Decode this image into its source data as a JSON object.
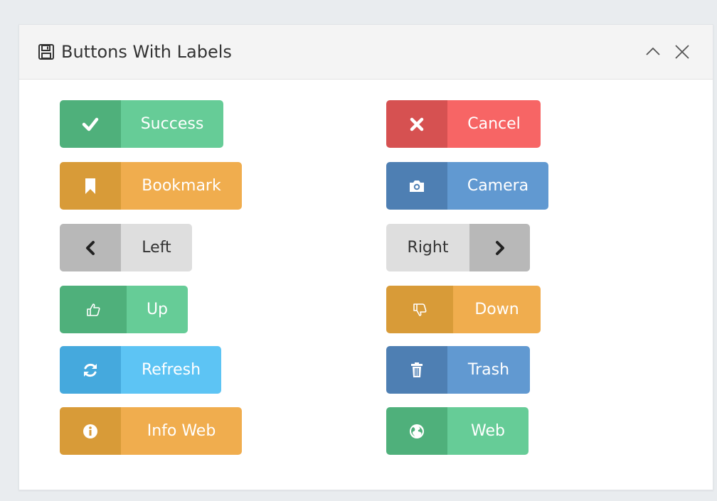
{
  "panel": {
    "title": "Buttons With Labels",
    "title_icon": "floppy-disk-icon",
    "tools": [
      "chevron-up-icon",
      "close-icon"
    ]
  },
  "buttons": {
    "success": {
      "label": "Success",
      "icon": "check-icon"
    },
    "cancel": {
      "label": "Cancel",
      "icon": "x-mark-icon"
    },
    "bookmark": {
      "label": "Bookmark",
      "icon": "bookmark-icon"
    },
    "camera": {
      "label": "Camera",
      "icon": "camera-icon"
    },
    "left": {
      "label": "Left",
      "icon": "chevron-left-icon"
    },
    "right": {
      "label": "Right",
      "icon": "chevron-right-icon"
    },
    "up": {
      "label": "Up",
      "icon": "thumbs-up-icon"
    },
    "down": {
      "label": "Down",
      "icon": "thumbs-down-icon"
    },
    "refresh": {
      "label": "Refresh",
      "icon": "refresh-icon"
    },
    "trash": {
      "label": "Trash",
      "icon": "trash-icon"
    },
    "info_web": {
      "label": "Info Web",
      "icon": "info-icon"
    },
    "web": {
      "label": "Web",
      "icon": "globe-icon"
    }
  },
  "colors": {
    "green_dark": "#4fb07b",
    "green": "#66cc97",
    "red_dark": "#d65151",
    "red": "#f76565",
    "orange_dark": "#d89b38",
    "orange": "#f0ad4e",
    "blue_dark": "#4e7fb3",
    "blue": "#6199d1",
    "gray_dark": "#b8b8b8",
    "gray": "#dedede",
    "sky_dark": "#45a9dd",
    "sky": "#5dc4f4"
  }
}
